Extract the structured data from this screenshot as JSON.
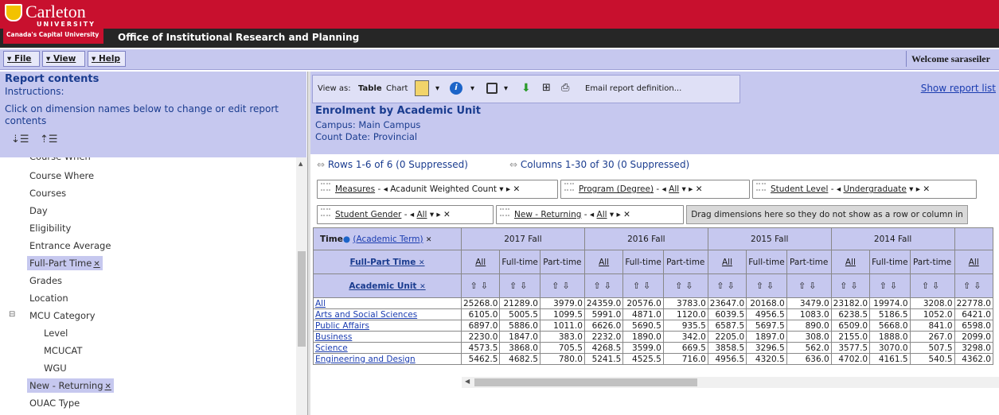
{
  "header": {
    "logo_name": "Carleton",
    "logo_university": "UNIVERSITY",
    "logo_tagline": "Canada's Capital University",
    "office_title": "Office of Institutional Research and Planning",
    "brand_color": "#c8102e"
  },
  "menubar": {
    "file": "File",
    "view": "View",
    "help": "Help",
    "welcome": "Welcome saraseiler"
  },
  "left_panel": {
    "title": "Report contents",
    "instructions_label": "Instructions:",
    "instructions_text": "Click on dimension names below to change or edit report contents",
    "items": [
      {
        "label": "Course When"
      },
      {
        "label": "Course Where"
      },
      {
        "label": "Courses"
      },
      {
        "label": "Day"
      },
      {
        "label": "Eligibility"
      },
      {
        "label": "Entrance Average"
      },
      {
        "label": "Full-Part Time"
      },
      {
        "label": "Grades"
      },
      {
        "label": "Location"
      },
      {
        "label": "MCU Category"
      },
      {
        "label": "Level"
      },
      {
        "label": "MCUCAT"
      },
      {
        "label": "WGU"
      },
      {
        "label": "New - Returning"
      },
      {
        "label": "OUAC Type"
      }
    ]
  },
  "toolbar": {
    "view_as": "View as:",
    "table": "Table",
    "chart": "Chart",
    "email": "Email report definition...",
    "show_list": "Show report list"
  },
  "report": {
    "title": "Enrolment by Academic Unit",
    "campus": "Campus: Main Campus",
    "count_date": "Count Date: Provincial",
    "rows_info": "Rows 1-6 of 6  (0 Suppressed)",
    "cols_info": "Columns 1-30 of 30  (0 Suppressed)"
  },
  "dimensions": {
    "measures": "Measures",
    "measures_value": "Acadunit Weighted Count",
    "program": "Program (Degree)",
    "program_value": "All",
    "student_level": "Student Level",
    "student_level_value": "Undergraduate",
    "gender": "Student Gender",
    "gender_value": "All",
    "new_returning": "New - Returning",
    "new_returning_value": "All",
    "drop_hint": "Drag dimensions here so they do not show as a row or column in table"
  },
  "grid": {
    "time_label": "Time",
    "time_sub": "(Academic Term)",
    "fpt_label": "Full-Part Time",
    "au_label": "Academic Unit",
    "terms": [
      "2017 Fall",
      "2016 Fall",
      "2015 Fall",
      "2014 Fall"
    ],
    "sub_cols": [
      "All",
      "Full-time",
      "Part-time"
    ],
    "rows": [
      {
        "label": "All",
        "values": [
          "25268.0",
          "21289.0",
          "3979.0",
          "24359.0",
          "20576.0",
          "3783.0",
          "23647.0",
          "20168.0",
          "3479.0",
          "23182.0",
          "19974.0",
          "3208.0",
          "22778.0"
        ]
      },
      {
        "label": "Arts and Social Sciences",
        "values": [
          "6105.0",
          "5005.5",
          "1099.5",
          "5991.0",
          "4871.0",
          "1120.0",
          "6039.5",
          "4956.5",
          "1083.0",
          "6238.5",
          "5186.5",
          "1052.0",
          "6421.0"
        ]
      },
      {
        "label": "Public Affairs",
        "values": [
          "6897.0",
          "5886.0",
          "1011.0",
          "6626.0",
          "5690.5",
          "935.5",
          "6587.5",
          "5697.5",
          "890.0",
          "6509.0",
          "5668.0",
          "841.0",
          "6598.0"
        ]
      },
      {
        "label": "Business",
        "values": [
          "2230.0",
          "1847.0",
          "383.0",
          "2232.0",
          "1890.0",
          "342.0",
          "2205.0",
          "1897.0",
          "308.0",
          "2155.0",
          "1888.0",
          "267.0",
          "2099.0"
        ]
      },
      {
        "label": "Science",
        "values": [
          "4573.5",
          "3868.0",
          "705.5",
          "4268.5",
          "3599.0",
          "669.5",
          "3858.5",
          "3296.5",
          "562.0",
          "3577.5",
          "3070.0",
          "507.5",
          "3298.0"
        ]
      },
      {
        "label": "Engineering and Design",
        "values": [
          "5462.5",
          "4682.5",
          "780.0",
          "5241.5",
          "4525.5",
          "716.0",
          "4956.5",
          "4320.5",
          "636.0",
          "4702.0",
          "4161.5",
          "540.5",
          "4362.0"
        ]
      }
    ]
  }
}
